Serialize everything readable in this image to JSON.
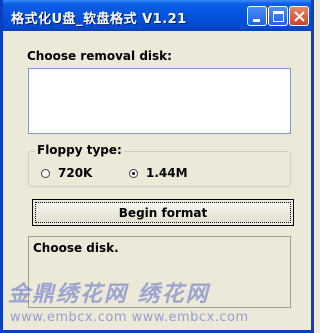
{
  "window": {
    "title": "格式化U盘_软盘格式 V1.21",
    "controls": {
      "minimize_icon": "minimize-icon",
      "maximize_icon": "maximize-icon",
      "close_icon": "close-icon"
    }
  },
  "disk": {
    "label": "Choose removal disk:"
  },
  "floppy": {
    "group_label": "Floppy type:",
    "options": [
      {
        "label": "720K",
        "selected": false
      },
      {
        "label": "1.44M",
        "selected": true
      }
    ]
  },
  "actions": {
    "begin_label": "Begin format"
  },
  "status": {
    "text": "Choose disk."
  },
  "watermark": {
    "text": "金鼎绣花网 绣花网",
    "url": "www.embcx.com www.embcx.com"
  },
  "colors": {
    "titlebar": "#0453dd",
    "face": "#ece9d8",
    "close": "#c8432a"
  }
}
